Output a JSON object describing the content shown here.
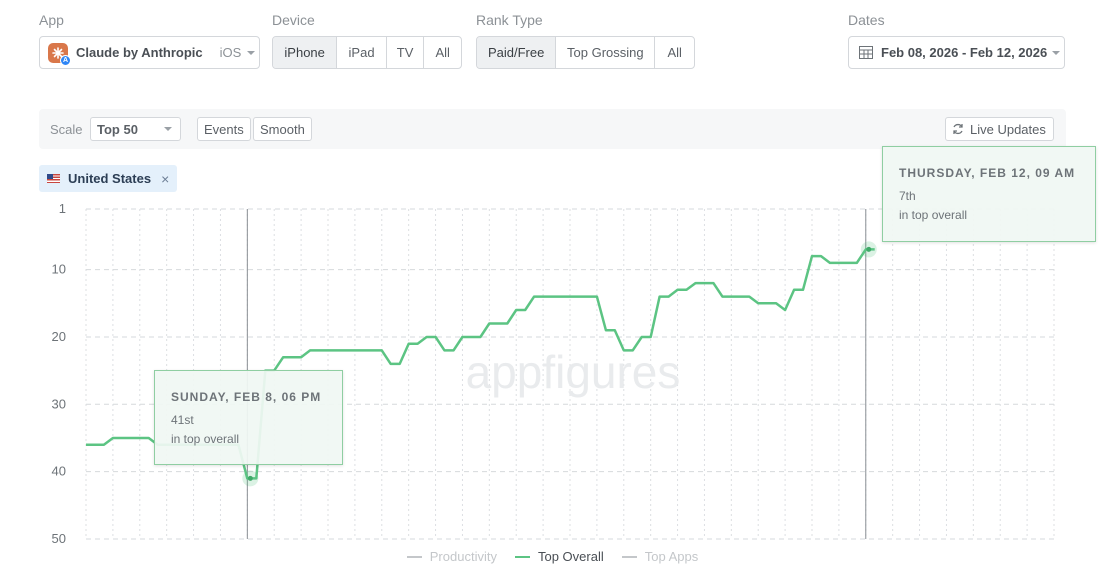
{
  "filters": {
    "app": {
      "label": "App",
      "name": "Claude by Anthropic",
      "platform": "iOS"
    },
    "device": {
      "label": "Device",
      "options": [
        "iPhone",
        "iPad",
        "TV",
        "All"
      ],
      "selected": "iPhone"
    },
    "rank_type": {
      "label": "Rank Type",
      "options": [
        "Paid/Free",
        "Top Grossing",
        "All"
      ],
      "selected": "Paid/Free"
    },
    "dates": {
      "label": "Dates",
      "value": "Feb 08, 2026 - Feb 12, 2026"
    }
  },
  "toolbar": {
    "scale_label": "Scale",
    "scale_value": "Top 50",
    "events_label": "Events",
    "smooth_label": "Smooth",
    "live_updates_label": "Live Updates"
  },
  "country_tag": {
    "label": "United States",
    "close": "×"
  },
  "watermark": "appfigures",
  "tooltips": [
    {
      "date": "Sunday, Feb 8, 06 PM",
      "rank": "41st",
      "desc": "in top overall"
    },
    {
      "date": "Thursday, Feb 12, 09 AM",
      "rank": "7th",
      "desc": "in top overall"
    }
  ],
  "colors": {
    "line": "#5cc483",
    "grid": "#d6d9dc",
    "tooltip_border": "#8fcea2",
    "legend_inactive": "#c4c7ca"
  },
  "chart_data": {
    "type": "line",
    "y_axis": {
      "inverted": true,
      "ylim": [
        1,
        50
      ],
      "ticks": [
        1,
        10,
        20,
        30,
        40,
        50
      ]
    },
    "x_range": [
      "2026-02-08 00:00",
      "2026-02-12 12:00"
    ],
    "grid": true,
    "legend_position": "bottom-center",
    "legend": [
      {
        "name": "Productivity",
        "active": false
      },
      {
        "name": "Top Overall",
        "active": true
      },
      {
        "name": "Top Apps",
        "active": false
      }
    ],
    "series": [
      {
        "name": "Top Overall",
        "points": [
          [
            "2026-02-08 00:00",
            36
          ],
          [
            "2026-02-08 02:00",
            36
          ],
          [
            "2026-02-08 03:00",
            35
          ],
          [
            "2026-02-08 07:00",
            35
          ],
          [
            "2026-02-08 08:00",
            36
          ],
          [
            "2026-02-08 17:00",
            36
          ],
          [
            "2026-02-08 18:00",
            41
          ],
          [
            "2026-02-08 19:00",
            41
          ],
          [
            "2026-02-08 20:00",
            25
          ],
          [
            "2026-02-08 21:00",
            25
          ],
          [
            "2026-02-08 22:00",
            23
          ],
          [
            "2026-02-09 00:00",
            23
          ],
          [
            "2026-02-09 01:00",
            22
          ],
          [
            "2026-02-09 09:00",
            22
          ],
          [
            "2026-02-09 10:00",
            24
          ],
          [
            "2026-02-09 11:00",
            24
          ],
          [
            "2026-02-09 12:00",
            21
          ],
          [
            "2026-02-09 13:00",
            21
          ],
          [
            "2026-02-09 14:00",
            20
          ],
          [
            "2026-02-09 15:00",
            20
          ],
          [
            "2026-02-09 16:00",
            22
          ],
          [
            "2026-02-09 17:00",
            22
          ],
          [
            "2026-02-09 18:00",
            20
          ],
          [
            "2026-02-09 20:00",
            20
          ],
          [
            "2026-02-09 21:00",
            18
          ],
          [
            "2026-02-09 23:00",
            18
          ],
          [
            "2026-02-10 00:00",
            16
          ],
          [
            "2026-02-10 01:00",
            16
          ],
          [
            "2026-02-10 02:00",
            14
          ],
          [
            "2026-02-10 09:00",
            14
          ],
          [
            "2026-02-10 10:00",
            19
          ],
          [
            "2026-02-10 11:00",
            19
          ],
          [
            "2026-02-10 12:00",
            22
          ],
          [
            "2026-02-10 13:00",
            22
          ],
          [
            "2026-02-10 14:00",
            20
          ],
          [
            "2026-02-10 15:00",
            20
          ],
          [
            "2026-02-10 16:00",
            14
          ],
          [
            "2026-02-10 17:00",
            14
          ],
          [
            "2026-02-10 18:00",
            13
          ],
          [
            "2026-02-10 19:00",
            13
          ],
          [
            "2026-02-10 20:00",
            12
          ],
          [
            "2026-02-10 22:00",
            12
          ],
          [
            "2026-02-10 23:00",
            14
          ],
          [
            "2026-02-11 02:00",
            14
          ],
          [
            "2026-02-11 03:00",
            15
          ],
          [
            "2026-02-11 05:00",
            15
          ],
          [
            "2026-02-11 06:00",
            16
          ],
          [
            "2026-02-11 07:00",
            13
          ],
          [
            "2026-02-11 08:00",
            13
          ],
          [
            "2026-02-11 09:00",
            8
          ],
          [
            "2026-02-11 10:00",
            8
          ],
          [
            "2026-02-11 11:00",
            9
          ],
          [
            "2026-02-11 14:00",
            9
          ],
          [
            "2026-02-11 15:00",
            7
          ],
          [
            "2026-02-11 16:00",
            7
          ]
        ]
      }
    ]
  }
}
